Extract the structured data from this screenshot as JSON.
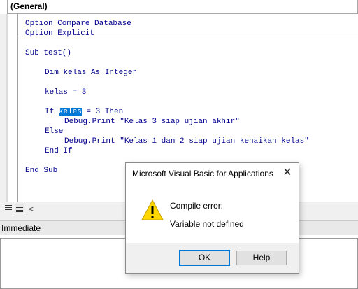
{
  "object_combo": {
    "value": "(General)"
  },
  "code": {
    "lines": [
      "Option Compare Database",
      "Option Explicit",
      "Sub test()",
      "Dim kelas As Integer",
      "kelas = 3",
      "If keles = 3 Then",
      "Debug.Print \"Kelas 3 siap ujian akhir\"",
      "Else",
      "Debug.Print \"Kelas 1 dan 2 siap ujian kenaikan kelas\"",
      "End If",
      "End Sub"
    ],
    "highlighted_word": "keles"
  },
  "view_buttons": {
    "procedure_view_icon": "procedure-view-icon",
    "full_module_view_icon": "full-module-view-icon",
    "scroll_left_icon": "chevron-left-icon",
    "scroll_left_glyph": "<"
  },
  "immediate": {
    "title": "Immediate"
  },
  "dialog": {
    "title": "Microsoft Visual Basic for Applications",
    "close_glyph": "✕",
    "icon": "warning-icon",
    "message_line1": "Compile error:",
    "message_line2": "Variable not defined",
    "ok_label": "OK",
    "help_label": "Help"
  },
  "colors": {
    "keyword": "#00008b",
    "selection": "#0078d7",
    "warning_yellow": "#ffd700"
  }
}
